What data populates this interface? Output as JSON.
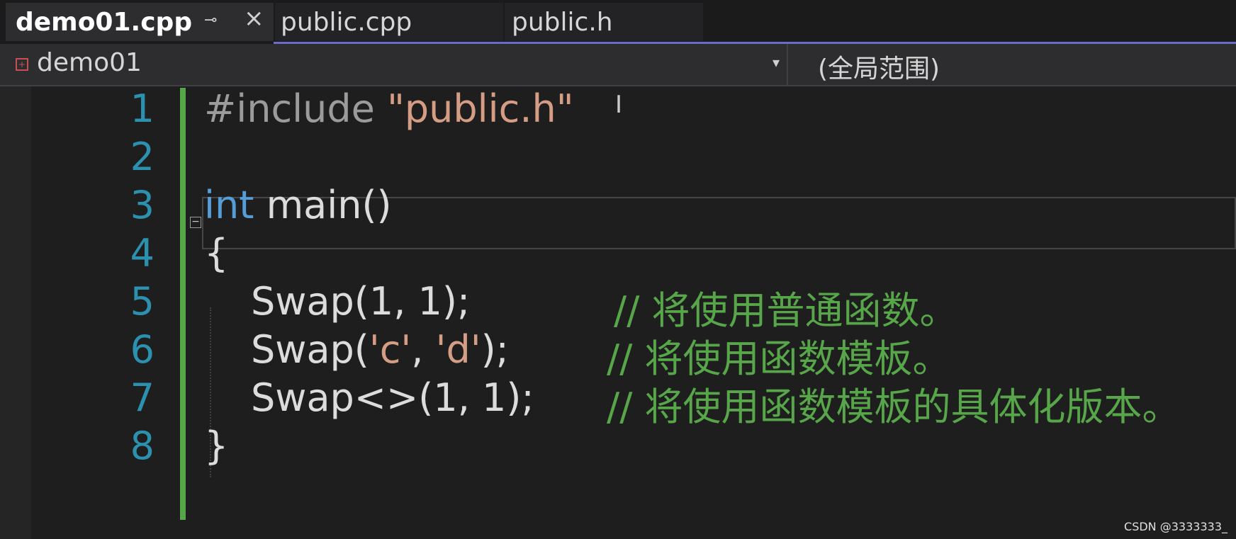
{
  "tabs": [
    {
      "label": "demo01.cpp",
      "active": true
    },
    {
      "label": "public.cpp",
      "active": false
    },
    {
      "label": "public.h",
      "active": false
    }
  ],
  "tab_icons": {
    "pin": "pin-icon",
    "close": "close-icon"
  },
  "nav": {
    "scope_left": "demo01",
    "scope_right": "(全局范围)",
    "file_icon": "cpp-file-icon"
  },
  "editor": {
    "line_numbers": [
      "1",
      "2",
      "3",
      "4",
      "5",
      "6",
      "7",
      "8"
    ],
    "code": {
      "l1_directive": "#include ",
      "l1_string": "\"public.h\"",
      "l3_keyword": "int",
      "l3_rest": " main()",
      "l4": "{",
      "l5_code": "Swap(1, 1);",
      "l5_comment": "// 将使用普通函数。",
      "l6_a": "Swap(",
      "l6_s1": "'c'",
      "l6_b": ", ",
      "l6_s2": "'d'",
      "l6_c": ");",
      "l6_comment": "// 将使用函数模板。",
      "l7_code": "Swap<>(1, 1);",
      "l7_comment": "// 将使用函数模板的具体化版本。",
      "l8": "}"
    }
  },
  "watermark": "CSDN @3333333_",
  "colors": {
    "keyword": "#569cd6",
    "string": "#d69d85",
    "comment": "#57a64a",
    "line_number": "#2b91af",
    "background": "#1e1e1e"
  }
}
